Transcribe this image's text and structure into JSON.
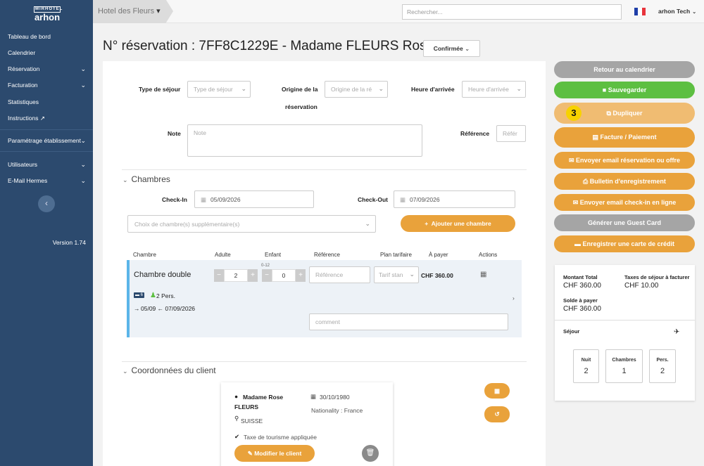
{
  "brand": {
    "line1": "MIRHOTEL",
    "line2": "arhon"
  },
  "sidebar": {
    "items": [
      {
        "label": "Tableau de bord"
      },
      {
        "label": "Calendrier"
      },
      {
        "label": "Réservation"
      },
      {
        "label": "Facturation"
      },
      {
        "label": "Statistiques"
      },
      {
        "label": "Instructions"
      },
      {
        "label": "Paramétrage établissement"
      },
      {
        "label": "Utilisateurs"
      },
      {
        "label": "E-Mail Hermes"
      }
    ],
    "version": "Version 1.74"
  },
  "topbar": {
    "hotel": "Hotel des Fleurs",
    "search_placeholder": "Rechercher...",
    "user": "arhon Tech",
    "flag_colors": [
      "#1f3fa8",
      "#ffffff",
      "#e8343c"
    ]
  },
  "header": {
    "title": "N° réservation : 7FF8C1229E - Madame FLEURS Rose",
    "status": "Confirmée"
  },
  "form": {
    "type_sejour_label": "Type de séjour",
    "type_sejour_placeholder": "Type de séjour",
    "origine_label_1": "Origine de la",
    "origine_label_2": "réservation",
    "origine_placeholder": "Origine de la ré",
    "heure_label": "Heure d'arrivée",
    "heure_placeholder": "Heure d'arrivée",
    "note_label": "Note",
    "note_placeholder": "Note",
    "reference_label": "Référence",
    "reference_placeholder": "Référ"
  },
  "chambres": {
    "section": "Chambres",
    "checkin_label": "Check-In",
    "checkin": "05/09/2026",
    "checkout_label": "Check-Out",
    "checkout": "07/09/2026",
    "extra_placeholder": "Choix de chambre(s) supplémentaire(s)",
    "add_button": "Ajouter une chambre",
    "columns": [
      "Chambre",
      "Adulte",
      "Enfant",
      "Référence",
      "Plan tarifaire",
      "À payer",
      "Actions"
    ],
    "row": {
      "name": "Chambre double",
      "adults": "2",
      "children_hint": "0-12",
      "children": "0",
      "reference_placeholder": "Référence",
      "plan": "Tarif stan",
      "price": "CHF 360.00",
      "bed_count": "6",
      "persons": "2 Pers.",
      "dates": "05/09 ← 07/09/2026",
      "comment_placeholder": "comment"
    }
  },
  "client": {
    "section": "Coordonnées du client",
    "name_1": "Madame  Rose",
    "name_2": "FLEURS",
    "birth": "30/10/1980",
    "nationality": "Nationality : France",
    "country": "SUISSE",
    "tax": "Taxe de tourisme appliquée",
    "modify_button": "Modifier le client"
  },
  "actions": {
    "back": "Retour au calendrier",
    "save": "Sauvegarder",
    "duplicate": "Dupliquer",
    "invoice": "Facture / Paiement",
    "email_res": "Envoyer email réservation ou offre",
    "bulletin": "Bulletin d'enregistrement",
    "email_checkin": "Envoyer email check-in en ligne",
    "guest_card": "Générer une Guest Card",
    "credit_card": "Enregistrer une carte de crédit",
    "badge": "3",
    "colors": {
      "gray": "#a5a5a5",
      "green": "#5dbf42",
      "orange": "#e9a23b",
      "orange_light": "#f0bc72"
    }
  },
  "summary": {
    "total_label": "Montant Total",
    "total": "CHF 360.00",
    "tax_label": "Taxes de séjour à facturer",
    "tax": "CHF 10.00",
    "balance_label": "Solde à payer",
    "balance": "CHF 360.00",
    "stay_label": "Séjour",
    "nights_label": "Nuit",
    "nights": "2",
    "rooms_label": "Chambres",
    "rooms": "1",
    "persons_label": "Pers.",
    "persons": "2"
  }
}
